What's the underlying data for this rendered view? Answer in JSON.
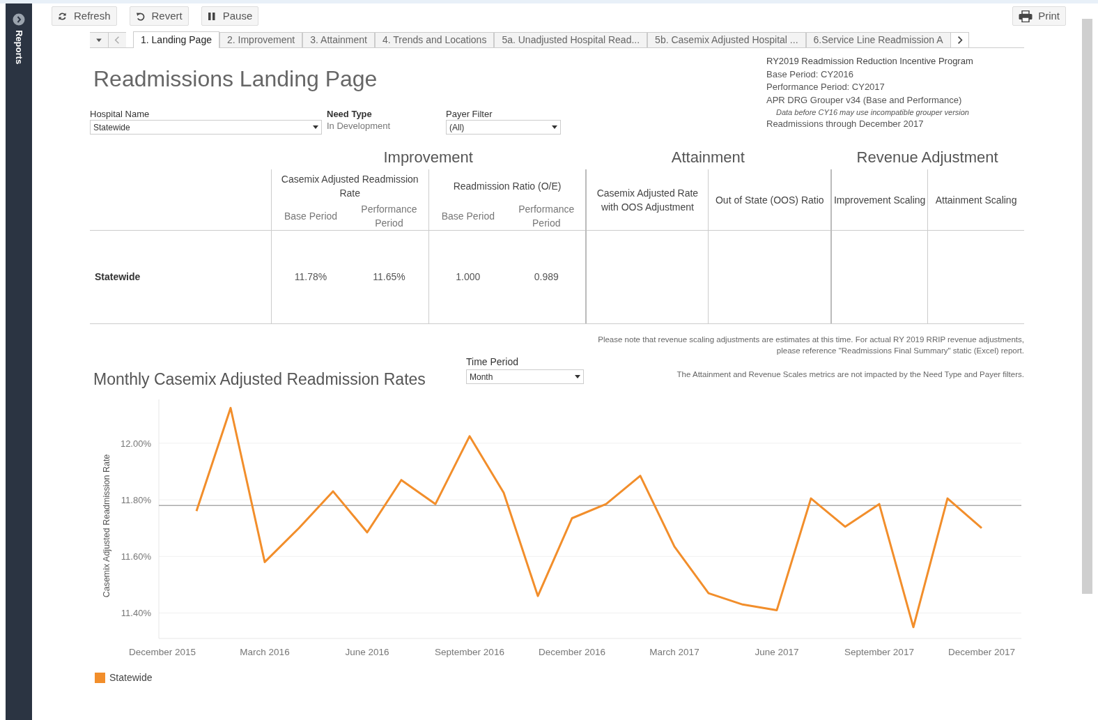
{
  "sidebar": {
    "label": "Reports"
  },
  "toolbar": {
    "buttons": [
      "Refresh",
      "Revert",
      "Pause"
    ],
    "print": "Print"
  },
  "tabs": [
    {
      "label": "1. Landing Page",
      "selected": true
    },
    {
      "label": "2. Improvement",
      "selected": false
    },
    {
      "label": "3. Attainment",
      "selected": false
    },
    {
      "label": "4. Trends and Locations",
      "selected": false
    },
    {
      "label": "5a. Unadjusted Hospital Read...",
      "selected": false
    },
    {
      "label": "5b. Casemix Adjusted Hospital ...",
      "selected": false
    },
    {
      "label": "6.Service Line Readmission A",
      "selected": false
    }
  ],
  "title": "Readmissions Landing Page",
  "filters": [
    {
      "label": "Hospital Name",
      "kind": "dropdown",
      "value": "Statewide"
    },
    {
      "label": "Need Type",
      "kind": "text",
      "value": "In Development"
    },
    {
      "label": "Payer Filter",
      "kind": "dropdown",
      "value": "(All)"
    }
  ],
  "info_lines": [
    {
      "text": "RY2019 Readmission Reduction Incentive Program",
      "kind": "heading"
    },
    {
      "text": "Base Period: CY2016",
      "kind": "normal"
    },
    {
      "text": "Performance Period: CY2017",
      "kind": "normal"
    },
    {
      "text": "APR DRG Grouper v34 (Base and Performance)",
      "kind": "normal"
    },
    {
      "text": "Data before CY16 may use incompatible grouper version",
      "kind": "note"
    },
    {
      "text": "Readmissions through December 2017",
      "kind": "normal"
    }
  ],
  "table": {
    "groups": [
      {
        "label": "Improvement",
        "metrics": [
          {
            "label": "Casemix Adjusted Readmission Rate",
            "periods": [
              "Base Period",
              "Performance Period"
            ]
          },
          {
            "label": "Readmission Ratio (O/E)",
            "periods": [
              "Base Period",
              "Performance Period"
            ]
          }
        ]
      },
      {
        "label": "Attainment",
        "metrics": [
          {
            "label": "Casemix Adjusted Rate with OOS Adjustment"
          },
          {
            "label": "Out of State (OOS) Ratio"
          }
        ]
      },
      {
        "label": "Revenue Adjustment",
        "metrics": [
          {
            "label": "Improvement Scaling"
          },
          {
            "label": "Attainment Scaling"
          }
        ]
      }
    ],
    "rows": [
      {
        "label": "Statewide",
        "values": [
          "11.78%",
          "11.65%",
          "1.000",
          "0.989"
        ]
      }
    ]
  },
  "notes": [
    "Please note that revenue scaling adjustments are estimates at this time. For actual RY 2019 RRIP revenue adjustments, please reference \"Readmissions Final Summary\" static (Excel) report.",
    "The Attainment and Revenue Scales metrics are not impacted by the Need Type and Payer filters."
  ],
  "trend": {
    "title": "Monthly Casemix Adjusted Readmission Rates",
    "time_filter": {
      "label": "Time Period",
      "value": "Month"
    },
    "chart_data": {
      "type": "line",
      "ylabel": "Casemix Adjusted Readmission Rate",
      "categories": [
        "December 2015",
        null,
        null,
        "March 2016",
        null,
        null,
        "June 2016",
        null,
        null,
        "September 2016",
        null,
        null,
        "December 2016",
        null,
        null,
        "March 2017",
        null,
        null,
        "June 2017",
        null,
        null,
        "September 2017",
        null,
        null,
        "December 2017"
      ],
      "series": [
        {
          "name": "Statewide",
          "color": "#f28e2b",
          "values": [
            null,
            11.76,
            12.125,
            11.58,
            11.7,
            11.83,
            11.685,
            11.87,
            11.785,
            12.025,
            11.825,
            11.46,
            11.735,
            11.785,
            11.885,
            11.635,
            11.47,
            11.43,
            11.41,
            11.805,
            11.705,
            11.785,
            11.35,
            11.805,
            11.7
          ]
        }
      ],
      "ylim": [
        11.31,
        12.155
      ],
      "yticks": [
        {
          "value": 11.4,
          "label": "11.40%"
        },
        {
          "value": 11.6,
          "label": "11.60%"
        },
        {
          "value": 11.8,
          "label": "11.80%"
        },
        {
          "value": 12.0,
          "label": "12.00%"
        }
      ],
      "grid": true,
      "ref_lines": [
        {
          "axis": "y",
          "value": 11.78
        }
      ]
    }
  }
}
